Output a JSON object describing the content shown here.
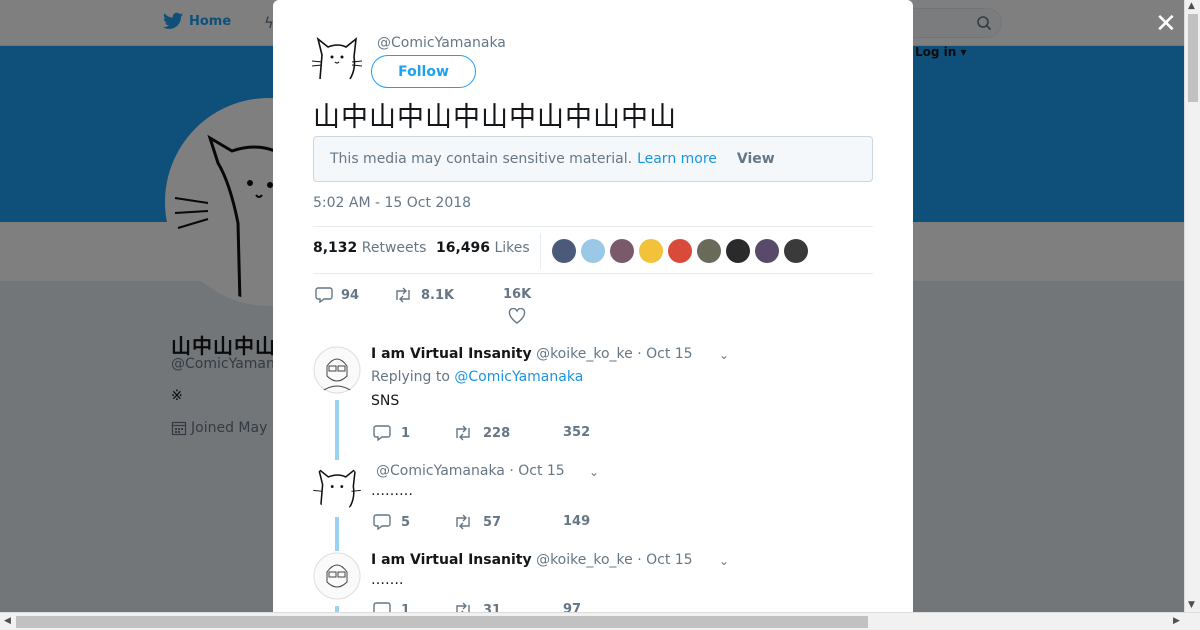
{
  "nav": {
    "home_label": "Home",
    "moments_glyph": "ϟ",
    "login_label": "Log in ▾"
  },
  "profile": {
    "name": "山中山中山中山",
    "handle": "@ComicYamanaka",
    "bio": "※",
    "joined_label": "Joined May"
  },
  "tweet": {
    "handle": "@ComicYamanaka",
    "follow_label": "Follow",
    "text": "山中山中山中山中山中山中山",
    "sensitive_text": "This media may contain sensitive material.",
    "learn_more": "Learn more",
    "view_label": "View",
    "timestamp": "5:02 AM - 15 Oct 2018",
    "retweets_count": "8,132",
    "retweets_label": "Retweets",
    "likes_count": "16,496",
    "likes_label": "Likes",
    "likers_colors": [
      "#4a5a78",
      "#9cc8e8",
      "#7a5a6a",
      "#f2c23a",
      "#d94a3a",
      "#6a6a5a",
      "#2a2a2a",
      "#5a4a6a",
      "#3a3a3a"
    ],
    "replies": "94",
    "retweets_short": "8.1K",
    "likes_short": "16K"
  },
  "replies": [
    {
      "name": "I am Virtual Insanity",
      "handle": "@koike_ko_ke",
      "date": "· Oct 15",
      "replying_prefix": "Replying to",
      "replying_to": "@ComicYamanaka",
      "body": "SNS",
      "reply_count": "1",
      "retweet_count": "228",
      "like_count": "352"
    },
    {
      "name": "",
      "handle": "@ComicYamanaka",
      "date": "· Oct 15",
      "body": "………",
      "reply_count": "5",
      "retweet_count": "57",
      "like_count": "149"
    },
    {
      "name": "I am Virtual Insanity",
      "handle": "@koike_ko_ke",
      "date": "· Oct 15",
      "body": "…….",
      "reply_count": "1",
      "retweet_count": "31",
      "like_count": "97"
    }
  ],
  "colors": {
    "accent": "#1da1f2",
    "banner": "#1da1f2",
    "thread_line": "#9ad2f4"
  }
}
